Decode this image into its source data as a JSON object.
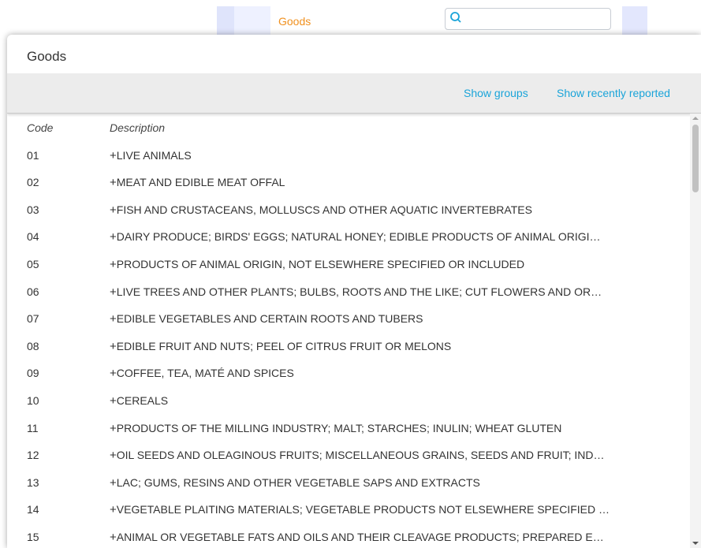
{
  "background": {
    "goods_label": "Goods",
    "search": {
      "placeholder": "",
      "icon": "search-icon"
    }
  },
  "modal": {
    "title": "Goods",
    "toolbar": {
      "show_groups": "Show groups",
      "show_recently_reported": "Show recently reported"
    },
    "table": {
      "headers": {
        "code": "Code",
        "description": "Description"
      },
      "rows": [
        {
          "code": "01",
          "description": "LIVE ANIMALS"
        },
        {
          "code": "02",
          "description": "MEAT AND EDIBLE MEAT OFFAL"
        },
        {
          "code": "03",
          "description": "FISH AND CRUSTACEANS, MOLLUSCS AND OTHER AQUATIC INVERTEBRATES"
        },
        {
          "code": "04",
          "description": "DAIRY PRODUCE; BIRDS' EGGS; NATURAL HONEY; EDIBLE PRODUCTS OF ANIMAL ORIGI…"
        },
        {
          "code": "05",
          "description": "PRODUCTS OF ANIMAL ORIGIN, NOT ELSEWHERE SPECIFIED OR INCLUDED"
        },
        {
          "code": "06",
          "description": "LIVE TREES AND OTHER PLANTS; BULBS, ROOTS AND THE LIKE; CUT FLOWERS AND OR…"
        },
        {
          "code": "07",
          "description": "EDIBLE VEGETABLES AND CERTAIN ROOTS AND TUBERS"
        },
        {
          "code": "08",
          "description": "EDIBLE FRUIT AND NUTS; PEEL OF CITRUS FRUIT OR MELONS"
        },
        {
          "code": "09",
          "description": "COFFEE, TEA, MATÉ AND SPICES"
        },
        {
          "code": "10",
          "description": "CEREALS"
        },
        {
          "code": "11",
          "description": "PRODUCTS OF THE MILLING INDUSTRY; MALT; STARCHES; INULIN; WHEAT GLUTEN"
        },
        {
          "code": "12",
          "description": "OIL SEEDS AND OLEAGINOUS FRUITS; MISCELLANEOUS GRAINS, SEEDS AND FRUIT; IND…"
        },
        {
          "code": "13",
          "description": "LAC; GUMS, RESINS AND OTHER VEGETABLE SAPS AND EXTRACTS"
        },
        {
          "code": "14",
          "description": "VEGETABLE PLAITING MATERIALS; VEGETABLE PRODUCTS NOT ELSEWHERE SPECIFIED …"
        },
        {
          "code": "15",
          "description": "ANIMAL OR VEGETABLE FATS AND OILS AND THEIR CLEAVAGE PRODUCTS; PREPARED E…"
        }
      ]
    }
  },
  "colors": {
    "accent_orange": "#f0901e",
    "link_blue": "#1aa4d9",
    "toolbar_bg": "#ececec"
  }
}
